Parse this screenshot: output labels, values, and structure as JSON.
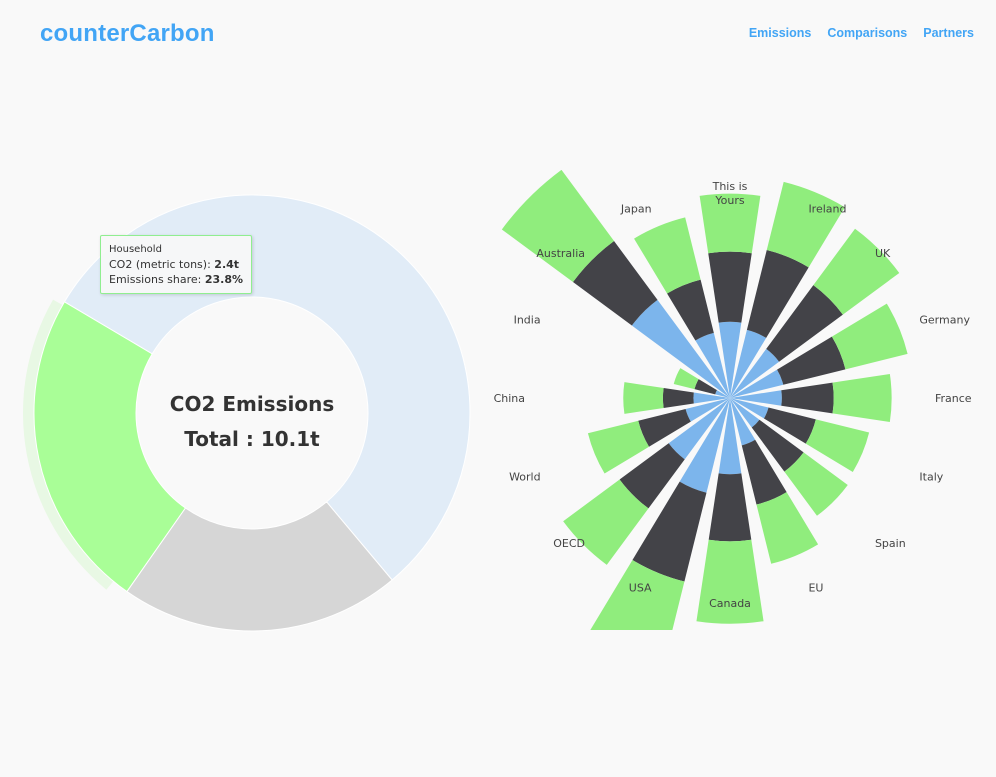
{
  "app": {
    "brand": "counterCarbon",
    "nav": [
      {
        "label": "Emissions"
      },
      {
        "label": "Comparisons"
      },
      {
        "label": "Partners"
      }
    ]
  },
  "donut": {
    "title_line1": "CO2 Emissions",
    "title_line2": "Total : 10.1t",
    "colors": {
      "household": "#a9fe97",
      "household_halo": "#e8f8e4",
      "segment_b": "#d6d6d6",
      "segment_c": "#e1ecf7"
    },
    "tooltip": {
      "category": "Household",
      "co2_label": "CO2 (metric tons):",
      "co2_value": "2.4t",
      "share_label": "Emissions share:",
      "share_value": "23.8%"
    }
  },
  "chart_data": {
    "type": "bar",
    "subtype": "polar-stacked",
    "categories": [
      "This is Yours",
      "Ireland",
      "UK",
      "Germany",
      "France",
      "Italy",
      "Spain",
      "EU",
      "Canada",
      "USA",
      "OECD",
      "World",
      "China",
      "India",
      "Australia",
      "Japan"
    ],
    "series": [
      {
        "color": "#7cb5ec",
        "values": [
          2.5,
          2.3,
          2.0,
          1.8,
          1.7,
          1.3,
          1.2,
          1.6,
          2.5,
          3.2,
          2.5,
          1.5,
          1.2,
          0.5,
          4.0,
          2.2
        ]
      },
      {
        "color": "#434348",
        "values": [
          2.3,
          2.7,
          2.6,
          2.1,
          1.7,
          1.6,
          1.8,
          2.0,
          2.2,
          3.0,
          2.0,
          1.6,
          1.0,
          0.7,
          2.4,
          1.8
        ]
      },
      {
        "color": "#90ed7d",
        "values": [
          1.9,
          2.3,
          2.3,
          2.1,
          1.9,
          1.8,
          1.8,
          2.0,
          2.7,
          3.1,
          2.3,
          1.7,
          1.3,
          0.7,
          2.9,
          2.1
        ]
      }
    ]
  }
}
